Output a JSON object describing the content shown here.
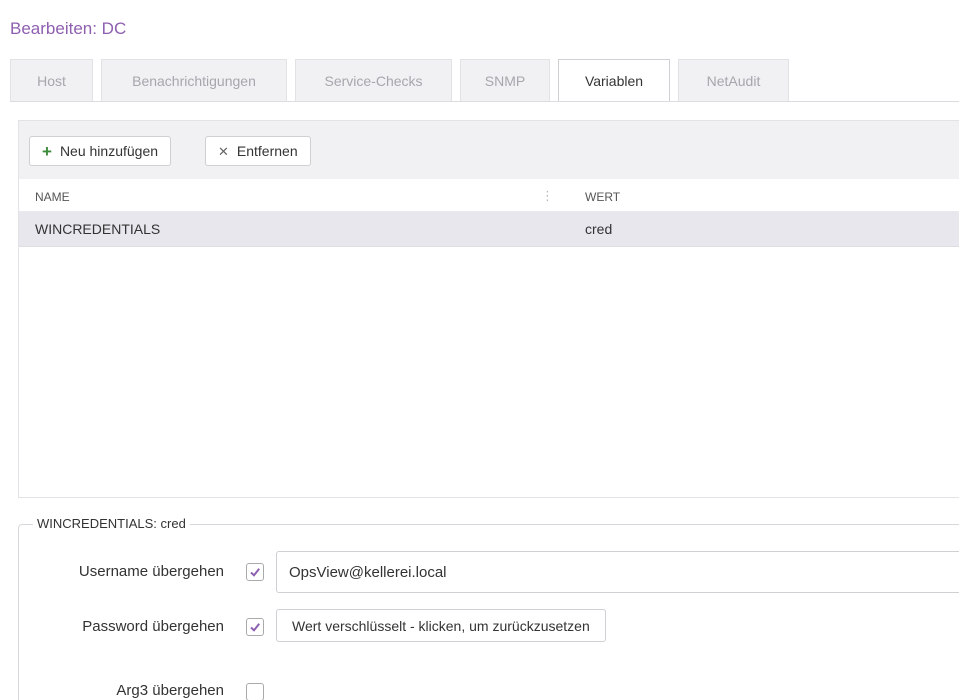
{
  "page": {
    "title": "Bearbeiten: DC"
  },
  "tabs": [
    {
      "label": "Host"
    },
    {
      "label": "Benachrichtigungen"
    },
    {
      "label": "Service-Checks"
    },
    {
      "label": "SNMP"
    },
    {
      "label": "Variablen",
      "active": true
    },
    {
      "label": "NetAudit"
    }
  ],
  "toolbar": {
    "add_label": "Neu hinzufügen",
    "add_icon": "plus-icon",
    "remove_label": "Entfernen",
    "remove_icon": "close-icon"
  },
  "grid": {
    "columns": [
      "NAME",
      "WERT"
    ],
    "rows": [
      {
        "name": "WINCREDENTIALS",
        "wert": "cred"
      }
    ]
  },
  "details": {
    "legend": "WINCREDENTIALS: cred",
    "fields": [
      {
        "label": "Username übergehen",
        "checked": true,
        "value": "OpsView@kellerei.local"
      },
      {
        "label": "Password übergehen",
        "checked": true,
        "button": "Wert verschlüsselt - klicken, um zurückzusetzen"
      },
      {
        "label": "Arg3 übergehen",
        "checked": false
      }
    ]
  },
  "colors": {
    "accent": "#8e5fb0",
    "add_green": "#3b8c3b",
    "selected_row": "#e9e7ee"
  }
}
